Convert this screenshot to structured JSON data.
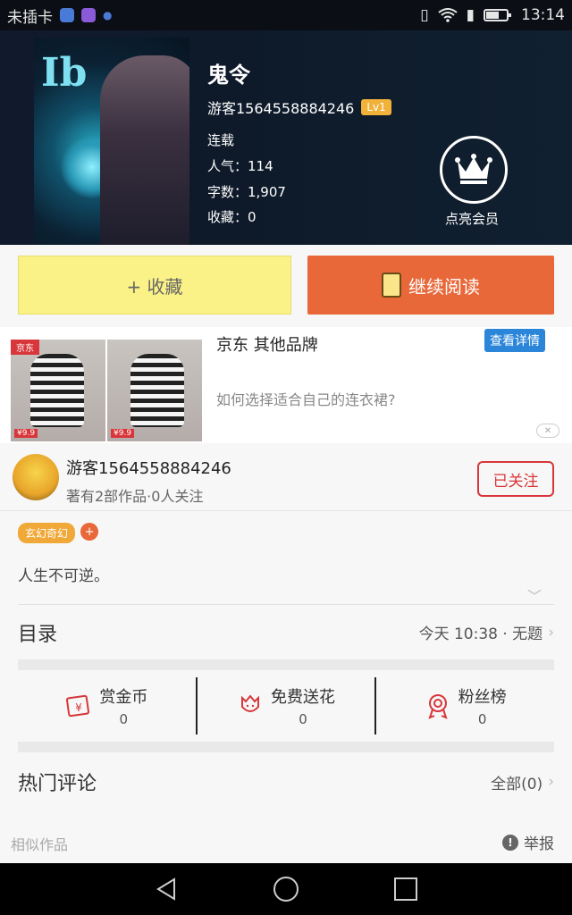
{
  "status_bar": {
    "carrier": "未插卡",
    "time": "13:14"
  },
  "book": {
    "title": "鬼令",
    "author": "游客1564558884246",
    "level": "Lv1",
    "status": "连载",
    "popularity": "人气：114",
    "word_count": "字数：1,907",
    "collections": "收藏：0",
    "vip_label": "点亮会员",
    "cover_logo_text": "Ib"
  },
  "actions": {
    "collect_label": "+ 收藏",
    "continue_label": "继续阅读"
  },
  "ad": {
    "source_tag": "京东",
    "title": "京东 其他品牌",
    "description": "如何选择适合自己的连衣裙?",
    "detail_button": "查看详情",
    "price_1": "¥9.9",
    "price_2": "¥9.9"
  },
  "author_card": {
    "name": "游客1564558884246",
    "stats": "著有2部作品·0人关注",
    "follow_button": "已关注"
  },
  "tags": [
    "玄幻奇幻"
  ],
  "tag_add": "+",
  "intro": "人生不可逆。",
  "catalog": {
    "title": "目录",
    "latest": "今天 10:38 · 无题"
  },
  "rewards": [
    {
      "label": "赏金币",
      "value": "0",
      "icon": "red-envelope-icon"
    },
    {
      "label": "免费送花",
      "value": "0",
      "icon": "flower-icon"
    },
    {
      "label": "粉丝榜",
      "value": "0",
      "icon": "medal-icon"
    }
  ],
  "comments": {
    "title": "热门评论",
    "all": "全部(0)"
  },
  "footer": {
    "similar": "相似作品",
    "report": "举报",
    "report_icon_glyph": "!"
  },
  "colors": {
    "accent_orange": "#e8683a",
    "collect_yellow": "#fbf287",
    "follow_red": "#d8363a",
    "tag_orange": "#f0a838",
    "jd_blue": "#2b86d9"
  }
}
